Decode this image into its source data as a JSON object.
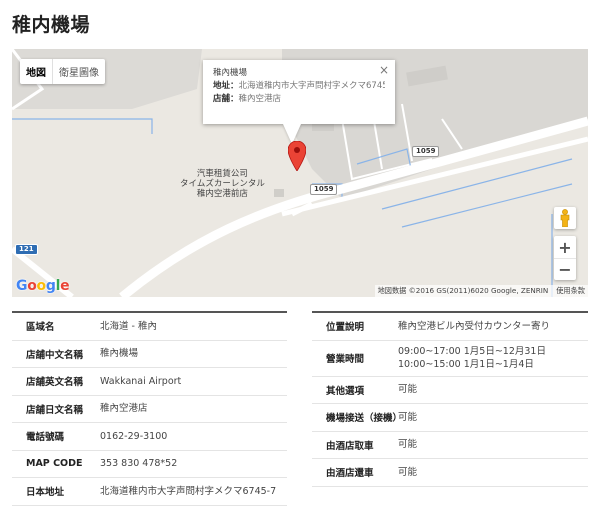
{
  "page": {
    "title": "稚内機場"
  },
  "map": {
    "type_buttons": {
      "map": "地図",
      "satellite": "衛星圖像"
    },
    "info_window": {
      "name": "稚內機場",
      "address_label": "地址：",
      "address_value": "北海道稚内市大字声問村字メクマ6745-7",
      "store_label": "店舗：",
      "store_value": "稚內空港店",
      "close": "×"
    },
    "labels": {
      "poi_line1": "汽車租賃公司",
      "poi_line2": "タイムズカーレンタル",
      "poi_line3": "稚内空港前店",
      "road_1059_a": "1059",
      "road_1059_b": "1059",
      "road_121": "121"
    },
    "zoom_in": "+",
    "zoom_out": "−",
    "attribution_data": "地図数据 ©2016 GS(2011)6020 Google, ZENRIN",
    "attribution_terms": "使用条款",
    "logo": {
      "g1": "G",
      "o1": "o",
      "o2": "o",
      "g2": "g",
      "l": "l",
      "e": "e"
    },
    "colors": {
      "land": "#ebe8e2",
      "road": "#ffffff",
      "water_line": "#8ab4e8",
      "pin": "#ea4335"
    }
  },
  "left_table": [
    {
      "key": "區域名",
      "value": "北海道 - 稚內"
    },
    {
      "key": "店舖中文名稱",
      "value": "稚內機場"
    },
    {
      "key": "店舖英文名稱",
      "value": "Wakkanai Airport"
    },
    {
      "key": "店舖日文名稱",
      "value": "稚內空港店"
    },
    {
      "key": "電話號碼",
      "value": "0162-29-3100"
    },
    {
      "key": "MAP CODE",
      "value": "353 830 478*52"
    },
    {
      "key": "日本地址",
      "value": "北海道稚内市大字声問村字メクマ6745-7"
    }
  ],
  "right_table": [
    {
      "key": "位置說明",
      "value": "稚內空港ビル內受付カウンター寄り",
      "value2": ""
    },
    {
      "key": "營業時間",
      "value": "09:00~17:00 1月5日~12月31日",
      "value2": "10:00~15:00 1月1日~1月4日"
    },
    {
      "key": "其他選項",
      "value": "可能",
      "value2": ""
    },
    {
      "key": "機場接送（接機）",
      "value": "可能",
      "value2": ""
    },
    {
      "key": "由酒店取車",
      "value": "可能",
      "value2": ""
    },
    {
      "key": "由酒店還車",
      "value": "可能",
      "value2": ""
    }
  ]
}
